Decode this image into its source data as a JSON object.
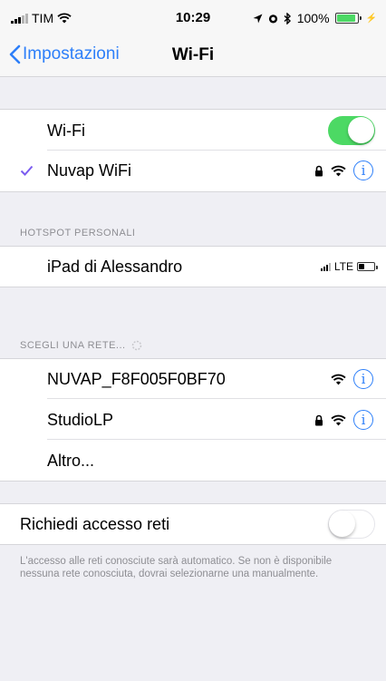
{
  "status_bar": {
    "carrier": "TIM",
    "time": "10:29",
    "battery": "100%"
  },
  "nav": {
    "back_label": "Impostazioni",
    "title": "Wi-Fi"
  },
  "wifi": {
    "label": "Wi-Fi",
    "enabled": true,
    "connected_network": "Nuvap WiFi"
  },
  "hotspot": {
    "header": "HOTSPOT PERSONALI",
    "device": "iPad di Alessandro",
    "network_type": "LTE"
  },
  "networks": {
    "header": "SCEGLI UNA RETE...",
    "items": [
      {
        "name": "NUVAP_F8F005F0BF70",
        "locked": false
      },
      {
        "name": "StudioLP",
        "locked": true
      }
    ],
    "other_label": "Altro..."
  },
  "ask_join": {
    "label": "Richiedi accesso reti",
    "enabled": false,
    "description": "L'accesso alle reti conosciute sarà automatico. Se non è disponibile nessuna rete conosciuta, dovrai selezionarne una manualmente."
  },
  "colors": {
    "accent": "#2d7ff9",
    "toggle_on": "#4cd964",
    "checkmark": "#7b5cf0"
  },
  "icons": {
    "lock": "lock-icon",
    "wifi": "wifi-signal-icon",
    "info": "info-icon",
    "back": "chevron-left-icon",
    "check": "checkmark-icon"
  }
}
